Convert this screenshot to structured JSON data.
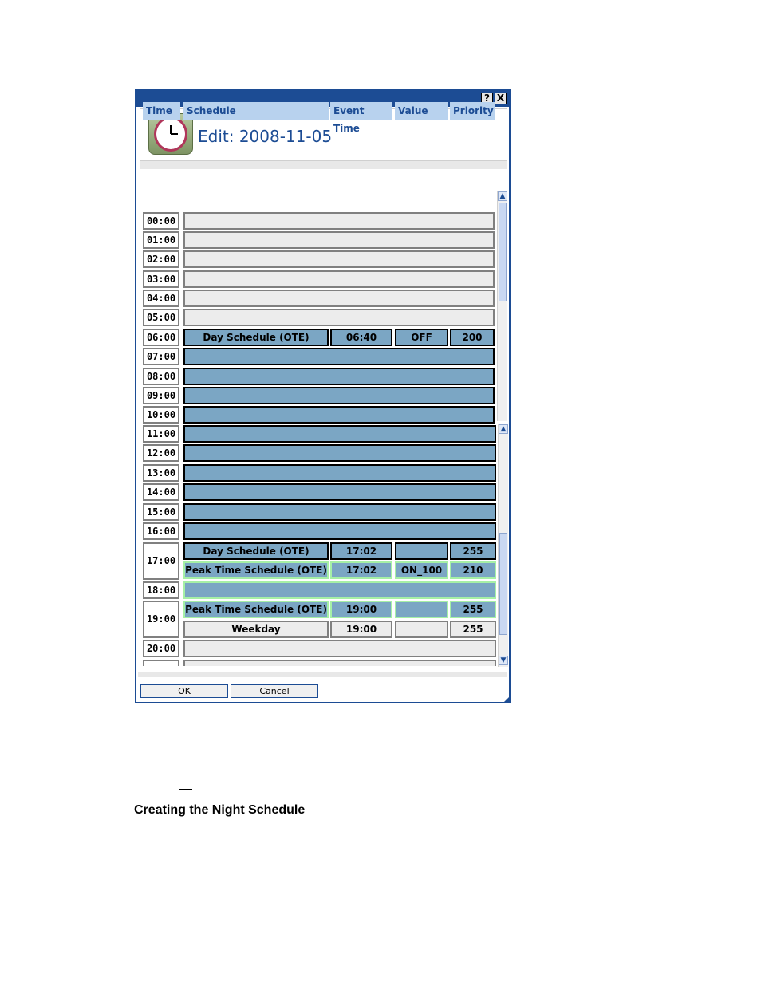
{
  "dialog": {
    "help_button": "?",
    "close_button": "X",
    "title": "Edit: 2008-11-05",
    "ok_label": "OK",
    "cancel_label": "Cancel"
  },
  "columns": [
    "Time",
    "Schedule",
    "Event Time",
    "Value",
    "Priority"
  ],
  "times": {
    "t00": "00:00",
    "t01": "01:00",
    "t02": "02:00",
    "t03": "03:00",
    "t04": "04:00",
    "t05": "05:00",
    "t06": "06:00",
    "t07": "07:00",
    "t08": "08:00",
    "t09": "09:00",
    "t10": "10:00",
    "t11": "11:00",
    "t12": "12:00",
    "t13": "13:00",
    "t14": "14:00",
    "t15": "15:00",
    "t16": "16:00",
    "t17": "17:00",
    "t18": "18:00",
    "t19": "19:00",
    "t20": "20:00"
  },
  "events": {
    "e06": {
      "schedule": "Day Schedule (OTE)",
      "event_time": "06:40",
      "value": "OFF",
      "priority": "200"
    },
    "e17a": {
      "schedule": "Day Schedule (OTE)",
      "event_time": "17:02",
      "value": "",
      "priority": "255"
    },
    "e17b": {
      "schedule": "Peak Time Schedule (OTE)",
      "event_time": "17:02",
      "value": "ON_100",
      "priority": "210"
    },
    "e19a": {
      "schedule": "Peak Time Schedule (OTE)",
      "event_time": "19:00",
      "value": "",
      "priority": "255"
    },
    "e19b": {
      "schedule": "Weekday",
      "event_time": "19:00",
      "value": "",
      "priority": "255"
    }
  },
  "caption": "Creating the Night Schedule",
  "colors": {
    "titlebar": "#1c4c94",
    "active_row": "#7ba6c4",
    "peak_border": "#a6f0a6",
    "header": "#b8d2ee"
  }
}
